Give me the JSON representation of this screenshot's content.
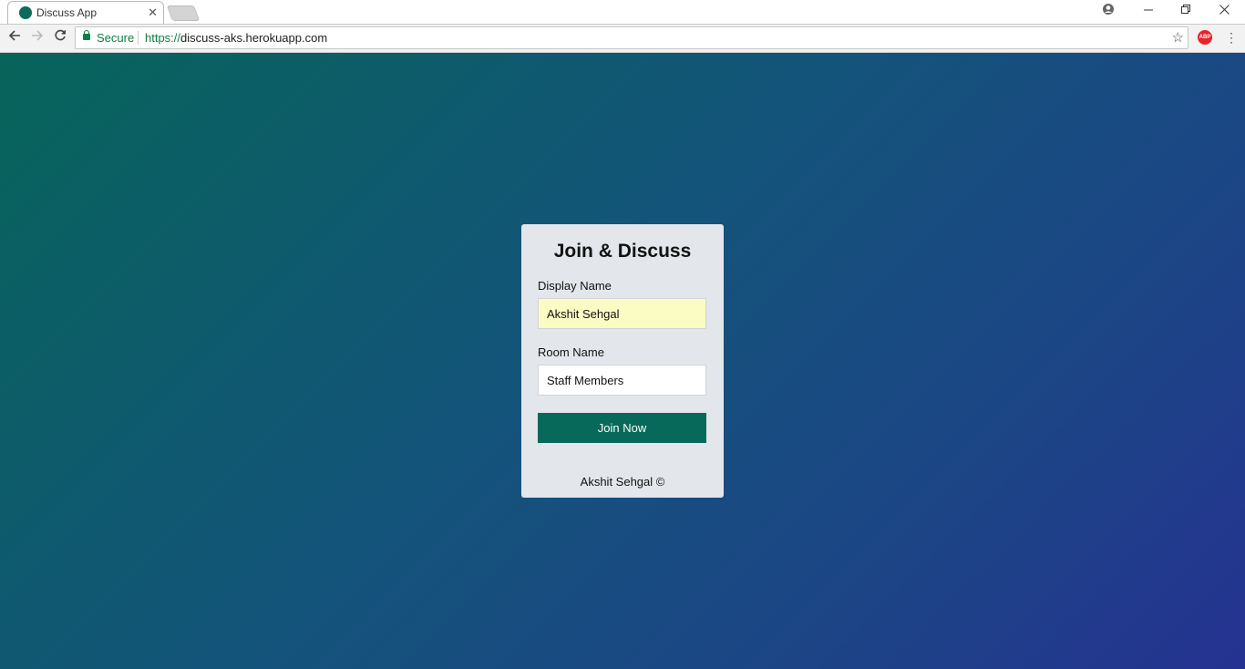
{
  "browser": {
    "tab_title": "Discuss App",
    "tab_close": "✕",
    "secure_label": "Secure",
    "url_protocol": "https://",
    "url_host": "discuss-aks.herokuapp.com",
    "abp_label": "ABP"
  },
  "card": {
    "title": "Join & Discuss",
    "display_name_label": "Display Name",
    "display_name_value": "Akshit Sehgal",
    "room_name_label": "Room Name",
    "room_name_value": "Staff Members",
    "join_button_label": "Join Now",
    "footer": "Akshit Sehgal ©"
  },
  "colors": {
    "accent": "#07695a",
    "autofill_bg": "#fbfcc4",
    "card_bg": "#e3e6ea"
  },
  "icons": {
    "back": "back-arrow-icon",
    "forward": "forward-arrow-icon",
    "reload": "reload-icon",
    "star": "bookmark-star-icon",
    "profile": "profile-icon",
    "menu": "kebab-menu-icon"
  }
}
